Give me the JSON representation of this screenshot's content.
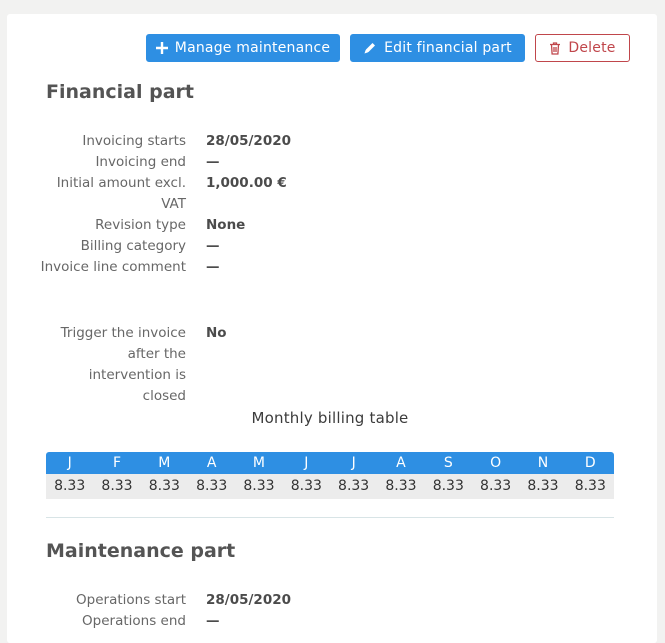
{
  "toolbar": {
    "manage_label": "Manage maintenance",
    "edit_label": "Edit financial part",
    "delete_label": "Delete"
  },
  "financial": {
    "title": "Financial part",
    "fields": [
      {
        "label": "Invoicing starts",
        "value": "28/05/2020"
      },
      {
        "label": "Invoicing end",
        "value": "—"
      },
      {
        "label": "Initial amount excl. VAT",
        "value": "1,000.00 €"
      },
      {
        "label": "Revision type",
        "value": "None"
      },
      {
        "label": "Billing category",
        "value": "—"
      },
      {
        "label": "Invoice line comment",
        "value": "—"
      },
      {
        "label": "Trigger the invoice after the intervention is closed",
        "value": "No"
      }
    ]
  },
  "billing_table": {
    "title": "Monthly billing table",
    "months": [
      "J",
      "F",
      "M",
      "A",
      "M",
      "J",
      "J",
      "A",
      "S",
      "O",
      "N",
      "D"
    ],
    "values": [
      "8.33",
      "8.33",
      "8.33",
      "8.33",
      "8.33",
      "8.33",
      "8.33",
      "8.33",
      "8.33",
      "8.33",
      "8.33",
      "8.33"
    ]
  },
  "maintenance": {
    "title": "Maintenance part",
    "fields": [
      {
        "label": "Operations start",
        "value": "28/05/2020"
      },
      {
        "label": "Operations end",
        "value": "—"
      }
    ]
  },
  "colors": {
    "primary": "#2e8fe3",
    "danger": "#c0464b"
  }
}
